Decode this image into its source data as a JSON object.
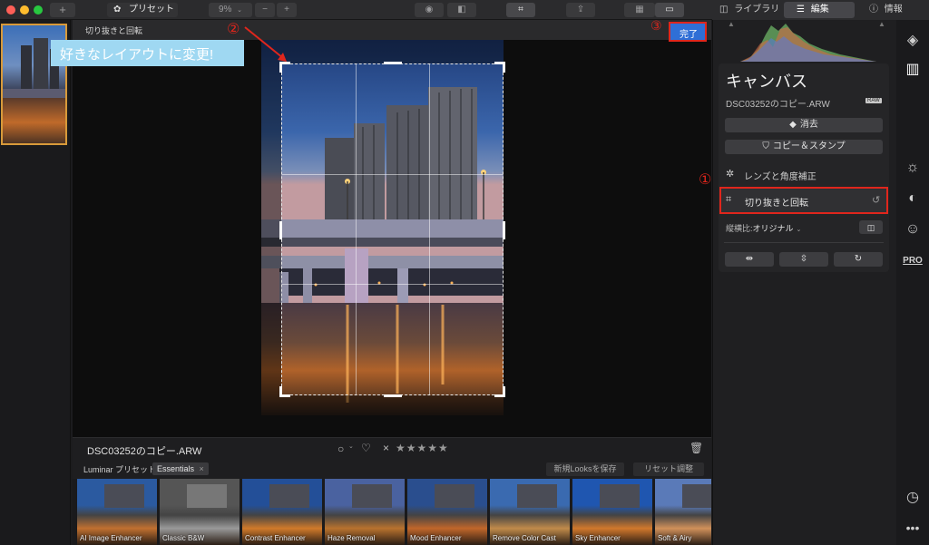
{
  "toolbar": {
    "add_label": "+",
    "presets_label": "プリセット",
    "zoom_value": "9%",
    "zoom_minus": "−",
    "zoom_plus": "+"
  },
  "right_tabs": {
    "library": "ライブラリ",
    "edit": "編集",
    "info": "情報"
  },
  "canvas": {
    "tool_title": "切り抜きと回転",
    "done_button": "完了"
  },
  "annotations": {
    "circle_1": "①",
    "circle_2": "②",
    "circle_3": "③",
    "callout": "好きなレイアウトに変更!"
  },
  "info_row": {
    "filename": "DSC03252のコピー.ARW",
    "rating_x": "×",
    "stars": "★★★★★"
  },
  "presets": {
    "label": "Luminar プリセット",
    "category": "Essentials",
    "save_looks": "新規Looksを保存",
    "reset": "リセット調整",
    "items": [
      {
        "name": "AI Image Enhancer"
      },
      {
        "name": "Classic B&W"
      },
      {
        "name": "Contrast Enhancer"
      },
      {
        "name": "Haze Removal"
      },
      {
        "name": "Mood Enhancer"
      },
      {
        "name": "Remove Color Cast"
      },
      {
        "name": "Sky Enhancer"
      },
      {
        "name": "Soft & Airy"
      }
    ]
  },
  "panel": {
    "title": "キャンバス",
    "filename": "DSC03252のコピー.ARW",
    "raw_badge": "RAW",
    "erase": "消去",
    "clone_stamp": "コピー＆スタンプ",
    "lens": "レンズと角度補正",
    "crop": "切り抜きと回転",
    "aspect_label": "縦横比:",
    "aspect_value": "オリジナル"
  },
  "icons": {
    "pro": "PRO"
  },
  "colors": {
    "accent_blue": "#2f6fd6",
    "annotation_red": "#e0261c",
    "selection_orange": "#d89a3a",
    "callout_bg": "#9fd8f2"
  }
}
